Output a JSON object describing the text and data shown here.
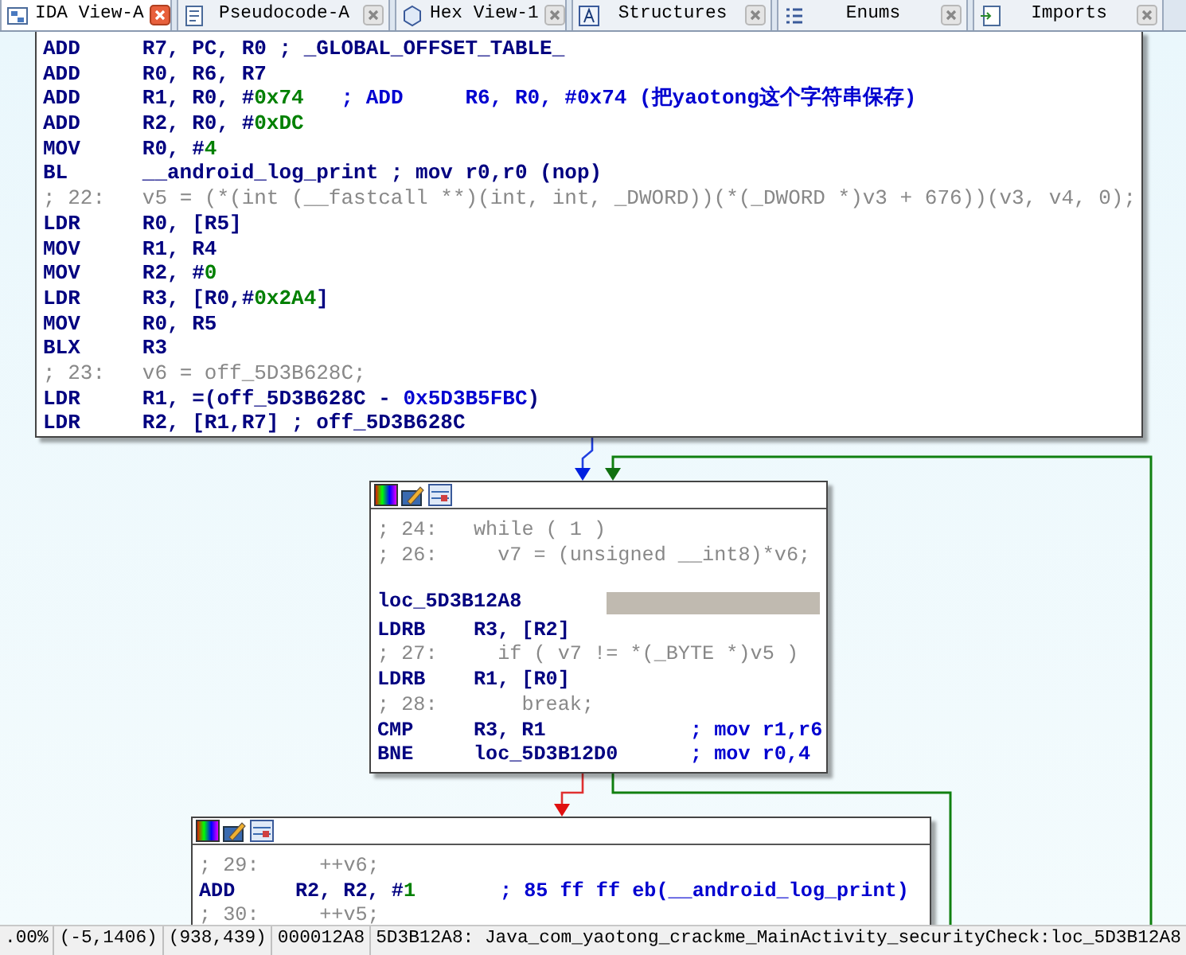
{
  "tabs": [
    {
      "label": "IDA View-A",
      "selected": true,
      "kind": "graph"
    },
    {
      "label": "Pseudocode-A",
      "selected": false,
      "kind": "pseudo"
    },
    {
      "label": "Hex View-1",
      "selected": false,
      "kind": "hex"
    },
    {
      "label": "Structures",
      "selected": false,
      "kind": "struct"
    },
    {
      "label": "Enums",
      "selected": false,
      "kind": "enum"
    },
    {
      "label": "Imports",
      "selected": false,
      "kind": "import"
    }
  ],
  "nodes": [
    {
      "toolbar": false,
      "lines": [
        {
          "kind": "insn",
          "mnemonic": "ADD",
          "operands": [
            {
              "text": "R7, PC, R0 ; _GLOBAL_OFFSET_TABLE_"
            }
          ]
        },
        {
          "kind": "insn",
          "mnemonic": "ADD",
          "operands": [
            {
              "text": "R0, R6, R7"
            }
          ]
        },
        {
          "kind": "insn",
          "mnemonic": "ADD",
          "operands": [
            {
              "text": "R1, R0, #"
            },
            {
              "text": "0x74",
              "kind": "number"
            },
            {
              "text": "   ; ADD     R6, R0, #0x74 (把yaotong这个字符串保存)",
              "kind": "comment"
            }
          ]
        },
        {
          "kind": "insn",
          "mnemonic": "ADD",
          "operands": [
            {
              "text": "R2, R0, #"
            },
            {
              "text": "0xDC",
              "kind": "number"
            }
          ]
        },
        {
          "kind": "insn",
          "mnemonic": "MOV",
          "operands": [
            {
              "text": "R0, #"
            },
            {
              "text": "4",
              "kind": "number"
            }
          ]
        },
        {
          "kind": "insn",
          "mnemonic": "BL",
          "operands": [
            {
              "text": "__android_log_print ; mov r0,r0 (nop)"
            }
          ]
        },
        {
          "kind": "pseudo",
          "text": "; 22:   v5 = (*(int (__fastcall **)(int, int, _DWORD))(*(_DWORD *)v3 + 676))(v3, v4, 0);"
        },
        {
          "kind": "insn",
          "mnemonic": "LDR",
          "operands": [
            {
              "text": "R0, [R5]"
            }
          ]
        },
        {
          "kind": "insn",
          "mnemonic": "MOV",
          "operands": [
            {
              "text": "R1, R4"
            }
          ]
        },
        {
          "kind": "insn",
          "mnemonic": "MOV",
          "operands": [
            {
              "text": "R2, #"
            },
            {
              "text": "0",
              "kind": "number"
            }
          ]
        },
        {
          "kind": "insn",
          "mnemonic": "LDR",
          "operands": [
            {
              "text": "R3, [R0,#"
            },
            {
              "text": "0x2A4",
              "kind": "number"
            },
            {
              "text": "]"
            }
          ]
        },
        {
          "kind": "insn",
          "mnemonic": "MOV",
          "operands": [
            {
              "text": "R0, R5"
            }
          ]
        },
        {
          "kind": "insn",
          "mnemonic": "BLX",
          "operands": [
            {
              "text": "R3"
            }
          ]
        },
        {
          "kind": "pseudo",
          "text": "; 23:   v6 = off_5D3B628C;"
        },
        {
          "kind": "insn",
          "mnemonic": "LDR",
          "operands": [
            {
              "text": "R1, =(off_5D3B628C - "
            },
            {
              "text": "0x5D3B5FBC",
              "kind": "comment"
            },
            {
              "text": ")"
            }
          ]
        },
        {
          "kind": "insn",
          "mnemonic": "LDR",
          "operands": [
            {
              "text": "R2, [R1,R7] ; off_5D3B628C"
            }
          ]
        }
      ]
    },
    {
      "toolbar": true,
      "lines": [
        {
          "kind": "pseudo",
          "text": "; 24:   while ( 1 )"
        },
        {
          "kind": "pseudo",
          "text": "; 26:     v7 = (unsigned __int8)*v6;"
        },
        {
          "kind": "blank"
        },
        {
          "kind": "label",
          "text": "loc_5D3B12A8",
          "highlighted": true
        },
        {
          "kind": "insn",
          "mnemonic": "LDRB",
          "operands": [
            {
              "text": "R3, [R2]"
            }
          ]
        },
        {
          "kind": "pseudo",
          "text": "; 27:     if ( v7 != *(_BYTE *)v5 )"
        },
        {
          "kind": "insn",
          "mnemonic": "LDRB",
          "operands": [
            {
              "text": "R1, [R0]"
            }
          ]
        },
        {
          "kind": "pseudo",
          "text": "; 28:       break;"
        },
        {
          "kind": "insn",
          "mnemonic": "CMP",
          "operands": [
            {
              "text": "R3, R1"
            },
            {
              "text": "            ; mov r1,r6",
              "kind": "comment"
            }
          ]
        },
        {
          "kind": "insn",
          "mnemonic": "BNE",
          "operands": [
            {
              "text": "loc_5D3B12D0"
            },
            {
              "text": "      ; mov r0,4",
              "kind": "comment"
            }
          ]
        }
      ]
    },
    {
      "toolbar": true,
      "lines": [
        {
          "kind": "pseudo",
          "text": "; 29:     ++v6;"
        },
        {
          "kind": "insn",
          "mnemonic": "ADD",
          "operands": [
            {
              "text": "R2, R2, #"
            },
            {
              "text": "1",
              "kind": "number"
            },
            {
              "text": "       ; 85 ff ff eb(__android_log_print)",
              "kind": "comment"
            }
          ]
        },
        {
          "kind": "pseudo",
          "text": "; 30:     ++v5;"
        }
      ]
    }
  ],
  "status_bar": [
    ".00%",
    "(-5,1406)",
    "(938,439)",
    "000012A8",
    "5D3B12A8: Java_com_yaotong_crackme_MainActivity_securityCheck:loc_5D3B12A8"
  ]
}
